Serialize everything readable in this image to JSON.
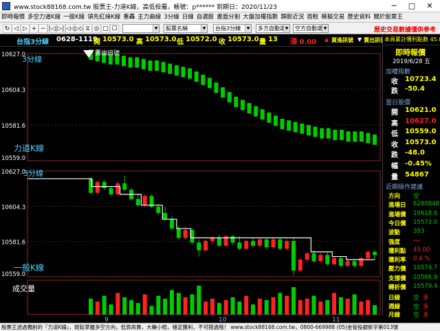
{
  "window": {
    "title": "www.stock88168.com.tw 股票王-力道K線，高低投屬，帳號：p****** 到期日：2020/11/23",
    "minimize": "─",
    "maximize": "□",
    "close": "✕"
  },
  "menu": [
    "即時報價",
    "多空力道K線",
    "一般K線",
    "領先紅綠K線",
    "重轟",
    "主力曲線",
    "3分線",
    "日線",
    "自選股",
    "畫面分割",
    "大盤加權指數",
    "類股近況",
    "首較",
    "模擬交易",
    "歷史資料",
    "關於股票王"
  ],
  "toolbar": {
    "buttons": [
      "↻",
      "◁",
      "▷",
      "+",
      "−",
      "|◁",
      "▷|",
      "◁◁",
      "▷▷",
      "⧖",
      "◎",
      "▢",
      "☐"
    ],
    "selects": [
      "",
      "股票名稱",
      "台指3分線",
      "多方自動選股",
      "空方自動選股"
    ],
    "risk_note": "歷史交易數據僅供參考"
  },
  "infobar": {
    "symbol": "台指3分線",
    "date_time": "0628-1119",
    "open_label": "開",
    "open": "10573.0",
    "high_label": "高",
    "high": "10573.0",
    "low_label": "低",
    "low": "10572.0",
    "close_label": "收",
    "close": "10573.0",
    "vol_label": "量",
    "vol": "13",
    "change": "漲 0.00",
    "buy_signal": "買進訊號",
    "sell_signal": "賣出訊號",
    "pnl": "本頁累計獲利點數 45.00"
  },
  "chart": {
    "upper_panel_label": "3分線",
    "upper_indicator": "力道K線",
    "upper_signal": "賣出訊號",
    "middle_panel_label": "3分線",
    "middle_indicator": "一般K線",
    "volume_label": "成交量",
    "y_ticks": [
      "10627.0",
      "10604.3",
      "10581.6",
      "10559.0"
    ],
    "x_ticks": [
      "9",
      "10",
      "11"
    ]
  },
  "colors": {
    "up": "#ff2222",
    "down": "#00cc00",
    "line": "#ffffff",
    "cyan": "#4dd0ff",
    "grid": "#703030"
  },
  "chart_data": {
    "type": "bar",
    "ylim": [
      10559.0,
      10627.0
    ],
    "x_labels": [
      "9",
      "10",
      "11"
    ],
    "force_k": [
      10627.0,
      10626.0,
      10625.0,
      10624.0,
      10624.0,
      10623.0,
      10622.0,
      10622.0,
      10621.0,
      10620.0,
      10620.0,
      10619.0,
      10618.0,
      10617.0,
      10616.0,
      10615.0,
      10613.0,
      10611.0,
      10609.0,
      10606.0,
      10603.0,
      10600.0,
      10597.0,
      10595.0,
      10593.0,
      10591.0,
      10589.0,
      10587.0,
      10585.0,
      10583.0,
      10582.0,
      10581.0,
      10580.0,
      10579.0,
      10578.0,
      10577.0,
      10577.0,
      10576.0,
      10576.0,
      10575.0,
      10575.0,
      10575.0,
      10574.0,
      10573.0
    ],
    "ohlc": [
      {
        "o": 10622,
        "h": 10623,
        "l": 10612,
        "c": 10613
      },
      {
        "o": 10613,
        "h": 10621,
        "l": 10612,
        "c": 10620
      },
      {
        "o": 10620,
        "h": 10621,
        "l": 10615,
        "c": 10616
      },
      {
        "o": 10616,
        "h": 10617,
        "l": 10611,
        "c": 10612
      },
      {
        "o": 10612,
        "h": 10620,
        "l": 10611,
        "c": 10619
      },
      {
        "o": 10619,
        "h": 10624,
        "l": 10614,
        "c": 10615
      },
      {
        "o": 10615,
        "h": 10616,
        "l": 10608,
        "c": 10609
      },
      {
        "o": 10609,
        "h": 10612,
        "l": 10604,
        "c": 10605
      },
      {
        "o": 10605,
        "h": 10612,
        "l": 10604,
        "c": 10611
      },
      {
        "o": 10611,
        "h": 10612,
        "l": 10603,
        "c": 10604
      },
      {
        "o": 10604,
        "h": 10606,
        "l": 10599,
        "c": 10600
      },
      {
        "o": 10600,
        "h": 10604,
        "l": 10595,
        "c": 10596
      },
      {
        "o": 10596,
        "h": 10598,
        "l": 10589,
        "c": 10590
      },
      {
        "o": 10590,
        "h": 10592,
        "l": 10583,
        "c": 10584
      },
      {
        "o": 10584,
        "h": 10591,
        "l": 10583,
        "c": 10589
      },
      {
        "o": 10589,
        "h": 10590,
        "l": 10580,
        "c": 10581
      },
      {
        "o": 10581,
        "h": 10583,
        "l": 10572,
        "c": 10576
      },
      {
        "o": 10576,
        "h": 10583,
        "l": 10575,
        "c": 10582
      },
      {
        "o": 10582,
        "h": 10585,
        "l": 10580,
        "c": 10584
      },
      {
        "o": 10584,
        "h": 10586,
        "l": 10578,
        "c": 10579
      },
      {
        "o": 10579,
        "h": 10586,
        "l": 10578,
        "c": 10585
      },
      {
        "o": 10585,
        "h": 10586,
        "l": 10580,
        "c": 10581
      },
      {
        "o": 10581,
        "h": 10585,
        "l": 10576,
        "c": 10577
      },
      {
        "o": 10577,
        "h": 10583,
        "l": 10576,
        "c": 10582
      },
      {
        "o": 10582,
        "h": 10584,
        "l": 10578,
        "c": 10579
      },
      {
        "o": 10579,
        "h": 10584,
        "l": 10578,
        "c": 10583
      },
      {
        "o": 10583,
        "h": 10584,
        "l": 10577,
        "c": 10578
      },
      {
        "o": 10578,
        "h": 10584,
        "l": 10577,
        "c": 10583
      },
      {
        "o": 10583,
        "h": 10584,
        "l": 10576,
        "c": 10577
      },
      {
        "o": 10577,
        "h": 10583,
        "l": 10576,
        "c": 10582
      },
      {
        "o": 10582,
        "h": 10584,
        "l": 10560,
        "c": 10563
      },
      {
        "o": 10563,
        "h": 10571,
        "l": 10562,
        "c": 10570
      },
      {
        "o": 10570,
        "h": 10575,
        "l": 10568,
        "c": 10574
      },
      {
        "o": 10574,
        "h": 10576,
        "l": 10568,
        "c": 10569
      },
      {
        "o": 10569,
        "h": 10574,
        "l": 10568,
        "c": 10573
      },
      {
        "o": 10573,
        "h": 10575,
        "l": 10566,
        "c": 10567
      },
      {
        "o": 10567,
        "h": 10572,
        "l": 10566,
        "c": 10571
      },
      {
        "o": 10571,
        "h": 10572,
        "l": 10565,
        "c": 10566
      },
      {
        "o": 10566,
        "h": 10570,
        "l": 10565,
        "c": 10569
      },
      {
        "o": 10569,
        "h": 10570,
        "l": 10565,
        "c": 10566
      },
      {
        "o": 10566,
        "h": 10572,
        "l": 10565,
        "c": 10571
      },
      {
        "o": 10571,
        "h": 10576,
        "l": 10570,
        "c": 10575
      },
      {
        "o": 10575,
        "h": 10576,
        "l": 10570,
        "c": 10573
      }
    ],
    "step_line": [
      10622,
      10622,
      10622,
      10617,
      10617,
      10617,
      10617,
      10612,
      10612,
      10612,
      10605,
      10605,
      10605,
      10596,
      10596,
      10590,
      10590,
      10584,
      10584,
      10584,
      10584,
      10584,
      10584,
      10584,
      10584,
      10584,
      10584,
      10584,
      10584,
      10584,
      10584,
      10584,
      10584,
      10584,
      10575,
      10575,
      10575,
      10572,
      10572,
      10570,
      10570,
      10570,
      10570
    ],
    "volume": [
      22,
      18,
      26,
      14,
      30,
      24,
      20,
      16,
      28,
      12,
      26,
      22,
      34,
      30,
      24,
      28,
      40,
      18,
      22,
      16,
      20,
      24,
      18,
      26,
      14,
      22,
      20,
      24,
      30,
      26,
      38,
      20,
      22,
      26,
      18,
      20,
      30,
      24,
      22,
      28,
      18,
      20,
      13
    ]
  },
  "rpanel": {
    "title": "即時報價",
    "date": "2019/6/28 五",
    "index_title": "加權指數",
    "index": [
      {
        "label": "收",
        "value": "10723.4",
        "color": "#ff0"
      },
      {
        "label": "跌",
        "value": "-50.4",
        "color": "#ff0"
      }
    ],
    "quote_title": "當日股價",
    "quote": [
      {
        "label": "開",
        "value": "10621.0",
        "color": "#ff0"
      },
      {
        "label": "高",
        "value": "10627.0",
        "color": "#ff2222"
      },
      {
        "label": "低",
        "value": "10559.0",
        "color": "#ff0"
      },
      {
        "label": "收",
        "value": "10573.0",
        "color": "#ff0"
      },
      {
        "label": "跌",
        "value": "-48.0",
        "color": "#ff0"
      },
      {
        "label": "幅",
        "value": "-0.45%",
        "color": "#ff0"
      },
      {
        "label": "量",
        "value": "54867",
        "color": "#ff0"
      }
    ],
    "ops_title": "近期操作建議",
    "ops": [
      {
        "label": "方向",
        "value": "空",
        "color": "#00cc00"
      },
      {
        "label": "進場日",
        "value": "6280848",
        "color": "#00cc00"
      },
      {
        "label": "進場價",
        "value": "10618.0",
        "color": "#00cc00"
      },
      {
        "label": "今日價",
        "value": "10573.0",
        "color": "#00cc00"
      },
      {
        "label": "波動",
        "value": "393",
        "color": "#00cc00"
      },
      {
        "label": "強度",
        "value": "──",
        "color": "#ff2222"
      },
      {
        "label": "獲利點",
        "value": "45.00",
        "color": "#ff2222"
      },
      {
        "label": "獲利率",
        "value": "0.4 %",
        "color": "#ff2222"
      },
      {
        "label": "壓力價",
        "value": "10574.7",
        "color": "#00cc00"
      },
      {
        "label": "支撐價",
        "value": "10566.9",
        "color": "#00cc00"
      },
      {
        "label": "轉折價",
        "value": "10579.4",
        "color": "#00cc00"
      }
    ],
    "trend": [
      {
        "label": "日線",
        "a": "空",
        "b": "多"
      },
      {
        "label": "週線",
        "a": "空",
        "b": "多"
      },
      {
        "label": "月線",
        "a": "空",
        "b": "多"
      }
    ]
  },
  "statusbar": "股票王透過獨創的『力道K線』，輕鬆掌握多空方向，低買高賣，大賺小賠，穩定獲利，不可錯過哦！ www.stock88168.com.tw，0800-669988 (05)金管投顧新字第013號"
}
